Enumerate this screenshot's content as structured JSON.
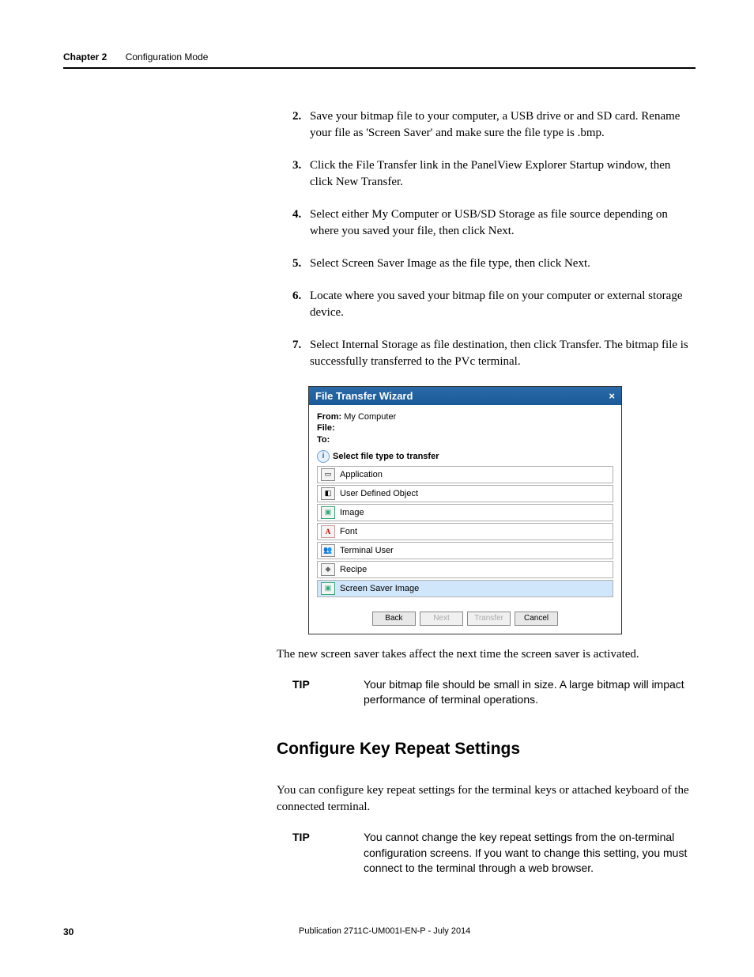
{
  "header": {
    "chapter": "Chapter 2",
    "title": "Configuration Mode"
  },
  "steps": [
    {
      "n": "2.",
      "t": "Save your bitmap file to your computer, a USB drive or and SD card. Rename your file as 'Screen Saver' and make sure the file type is .bmp."
    },
    {
      "n": "3.",
      "t": "Click the File Transfer link in the PanelView Explorer Startup window, then click New Transfer."
    },
    {
      "n": "4.",
      "t": "Select either My Computer or USB/SD Storage as file source depending on where you saved your file, then click Next."
    },
    {
      "n": "5.",
      "t": "Select Screen Saver Image as the file type, then click Next."
    },
    {
      "n": "6.",
      "t": "Locate where you saved your bitmap file on your computer or external storage device."
    },
    {
      "n": "7.",
      "t": "Select Internal Storage as file destination, then click Transfer. The bitmap file is successfully transferred to the PVc terminal."
    }
  ],
  "dialog": {
    "title": "File Transfer Wizard",
    "from_label": "From:",
    "from_value": "My Computer",
    "file_label": "File:",
    "to_label": "To:",
    "prompt": "Select file type to transfer",
    "items": [
      {
        "icon": "app",
        "label": "Application"
      },
      {
        "icon": "udo",
        "label": "User Defined Object"
      },
      {
        "icon": "img",
        "label": "Image"
      },
      {
        "icon": "font",
        "label": "Font"
      },
      {
        "icon": "user",
        "label": "Terminal User"
      },
      {
        "icon": "recipe",
        "label": "Recipe"
      },
      {
        "icon": "img",
        "label": "Screen Saver Image",
        "selected": true
      }
    ],
    "buttons": {
      "back": "Back",
      "next": "Next",
      "transfer": "Transfer",
      "cancel": "Cancel"
    }
  },
  "after_dialog": "The new screen saver takes affect the next time the screen saver is activated.",
  "tip1": {
    "label": "TIP",
    "text": "Your bitmap file should be small in size. A large bitmap will impact performance of terminal operations."
  },
  "section": "Configure Key Repeat Settings",
  "section_para": "You can configure key repeat settings for the terminal keys or attached keyboard of the connected terminal.",
  "tip2": {
    "label": "TIP",
    "text": "You cannot change the key repeat settings from the on-terminal configuration screens. If you want to change this setting, you must connect to the terminal through a web browser."
  },
  "footer": {
    "page": "30",
    "pub": "Publication 2711C-UM001I-EN-P - July 2014"
  }
}
